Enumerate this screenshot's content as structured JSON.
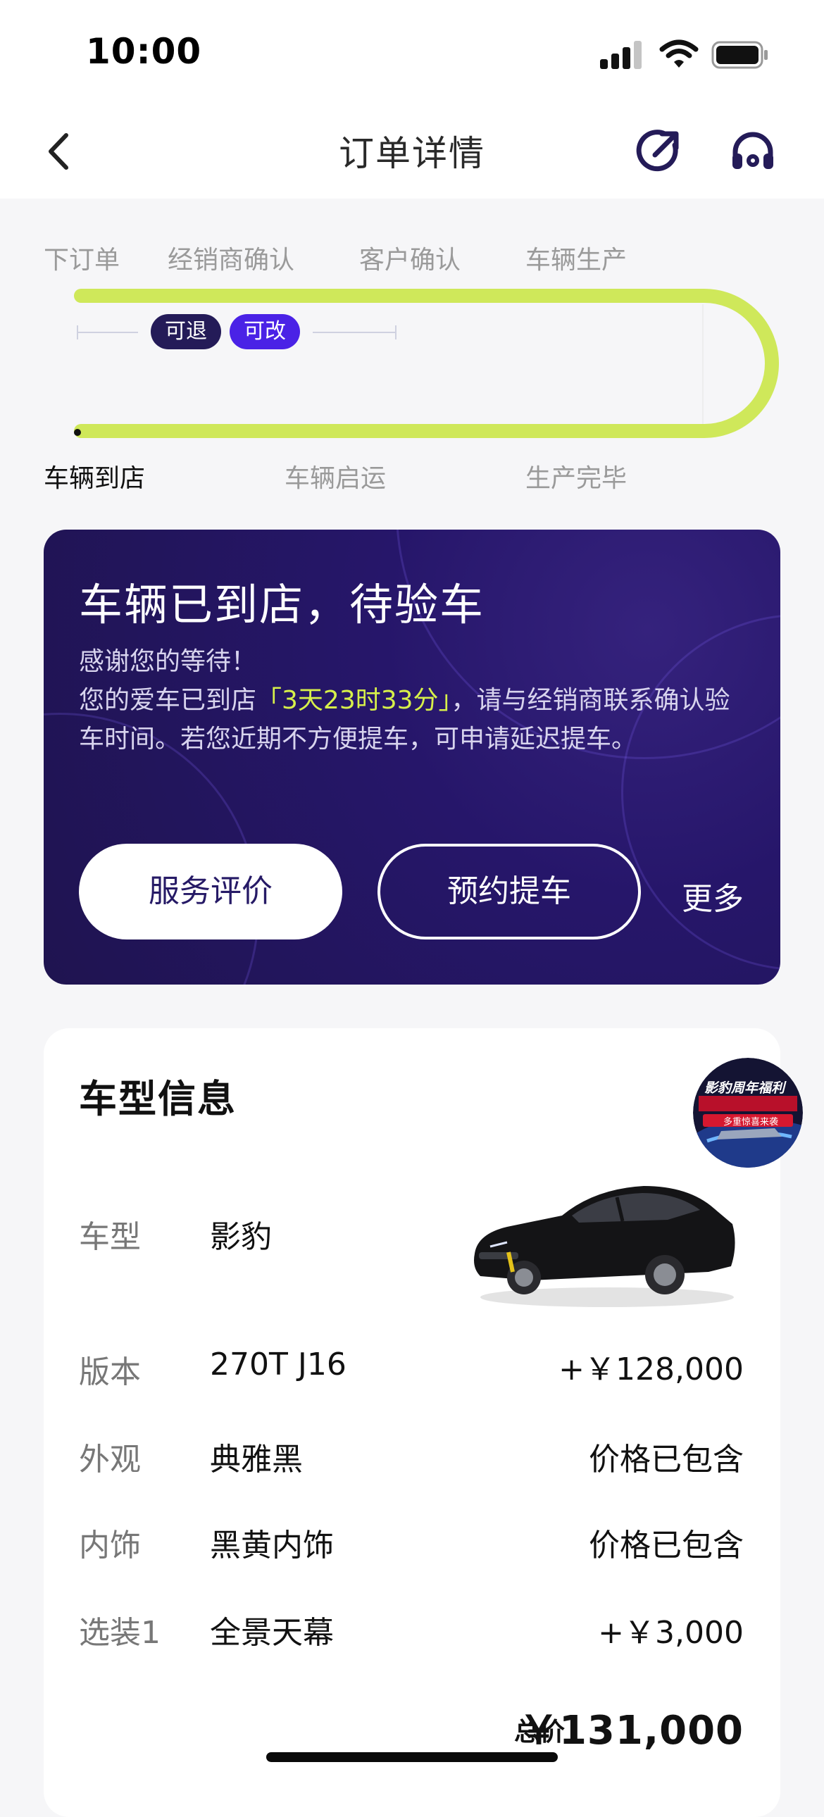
{
  "status_bar": {
    "time": "10:00"
  },
  "nav": {
    "title": "订单详情"
  },
  "progress": {
    "steps_top": [
      "下订单",
      "经销商确认",
      "客户确认",
      "车辆生产"
    ],
    "steps_bottom": [
      "车辆到店",
      "车辆启运",
      "生产完毕"
    ],
    "tags": [
      "可退",
      "可改"
    ],
    "colors": {
      "track": "#cfe85a",
      "active_text": "#111111"
    }
  },
  "status_card": {
    "title": "车辆已到店，待验车",
    "line1": "感谢您的等待！",
    "line2_prefix": "您的爱车已到店",
    "countdown": "「3天23时33分」",
    "line2_suffix": "，请与经销商联系确认验车时间。若您近期不方便提车，可申请延迟提车。",
    "buttons": {
      "review": "服务评价",
      "pickup": "预约提车",
      "more": "更多"
    }
  },
  "car_info": {
    "title": "车型信息",
    "promo": {
      "line1": "影豹周年福利",
      "line2": "多重惊喜来袭"
    },
    "rows": [
      {
        "label": "车型",
        "value": "影豹",
        "price": ""
      },
      {
        "label": "版本",
        "value": "270T J16",
        "price": "+￥128,000"
      },
      {
        "label": "外观",
        "value": "典雅黑",
        "price": "价格已包含"
      },
      {
        "label": "内饰",
        "value": "黑黄内饰",
        "price": "价格已包含"
      },
      {
        "label": "选装1",
        "value": "全景天幕",
        "price": "+￥3,000"
      }
    ],
    "total_label": "总价",
    "total_value": "￥131,000"
  }
}
